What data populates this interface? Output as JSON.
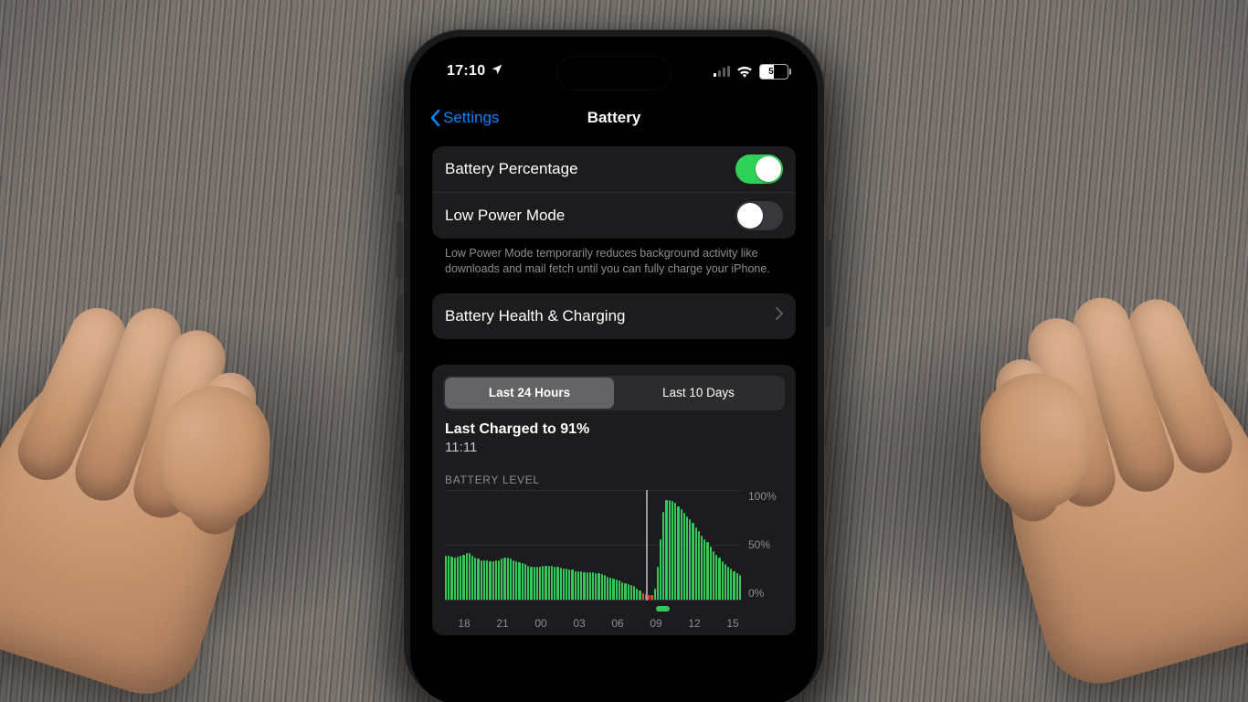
{
  "status_bar": {
    "time": "17:10",
    "battery_text": "50"
  },
  "nav": {
    "back_label": "Settings",
    "title": "Battery"
  },
  "toggles": {
    "battery_percentage": {
      "label": "Battery Percentage",
      "value": true
    },
    "low_power_mode": {
      "label": "Low Power Mode",
      "value": false
    },
    "footnote": "Low Power Mode temporarily reduces background activity like downloads and mail fetch until you can fully charge your iPhone."
  },
  "health": {
    "label": "Battery Health & Charging"
  },
  "usage": {
    "segments": [
      "Last 24 Hours",
      "Last 10 Days"
    ],
    "selected_segment": 0,
    "last_charged_label": "Last Charged to 91%",
    "last_charged_time": "11:11"
  },
  "chart_data": {
    "type": "bar",
    "title": "BATTERY LEVEL",
    "x_ticks": [
      "18",
      "21",
      "00",
      "03",
      "06",
      "09",
      "12",
      "15"
    ],
    "y_ticks": [
      "100%",
      "50%",
      "0%"
    ],
    "ylim": [
      0,
      100
    ],
    "values": [
      40,
      40,
      39,
      38,
      39,
      40,
      41,
      42,
      42,
      40,
      38,
      37,
      36,
      36,
      36,
      35,
      35,
      36,
      36,
      37,
      38,
      38,
      37,
      36,
      35,
      34,
      33,
      32,
      31,
      30,
      30,
      30,
      30,
      31,
      31,
      31,
      31,
      30,
      30,
      29,
      28,
      28,
      27,
      27,
      26,
      26,
      26,
      25,
      25,
      25,
      25,
      24,
      24,
      23,
      22,
      21,
      20,
      19,
      18,
      17,
      16,
      15,
      14,
      13,
      12,
      10,
      8,
      6,
      5,
      4,
      4,
      10,
      30,
      55,
      80,
      91,
      91,
      90,
      88,
      85,
      82,
      79,
      76,
      73,
      70,
      66,
      62,
      58,
      55,
      52,
      48,
      44,
      41,
      38,
      35,
      32,
      30,
      28,
      26,
      24,
      22
    ],
    "low_threshold": 6,
    "cursor_fraction": 0.68,
    "charge_pills": [
      {
        "left_fraction": 0.695,
        "width_fraction": 0.045
      }
    ]
  }
}
